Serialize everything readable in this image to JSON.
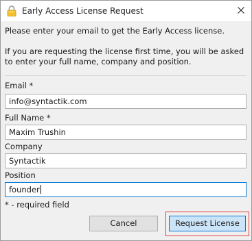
{
  "window": {
    "title": "Early Access License Request",
    "title_icon": "lock-icon",
    "close_icon": "close-icon"
  },
  "intro": {
    "line1": "Please enter your email to get the Early Access license.",
    "line2": "If you are requesting the license first time, you will be asked",
    "line3": "to enter your full name, company and position."
  },
  "form": {
    "email_label": "Email *",
    "email_value": "info@syntactik.com",
    "fullname_label": "Full Name *",
    "fullname_value": "Maxim Trushin",
    "company_label": "Company",
    "company_value": "Syntactik",
    "position_label": "Position",
    "position_value": "founder",
    "required_note": "* - required field"
  },
  "buttons": {
    "cancel_label": "Cancel",
    "request_label": "Request License"
  },
  "colors": {
    "primary_button_bg": "#cce4f7",
    "primary_button_border": "#0078d7",
    "highlight": "#e03a3a"
  }
}
